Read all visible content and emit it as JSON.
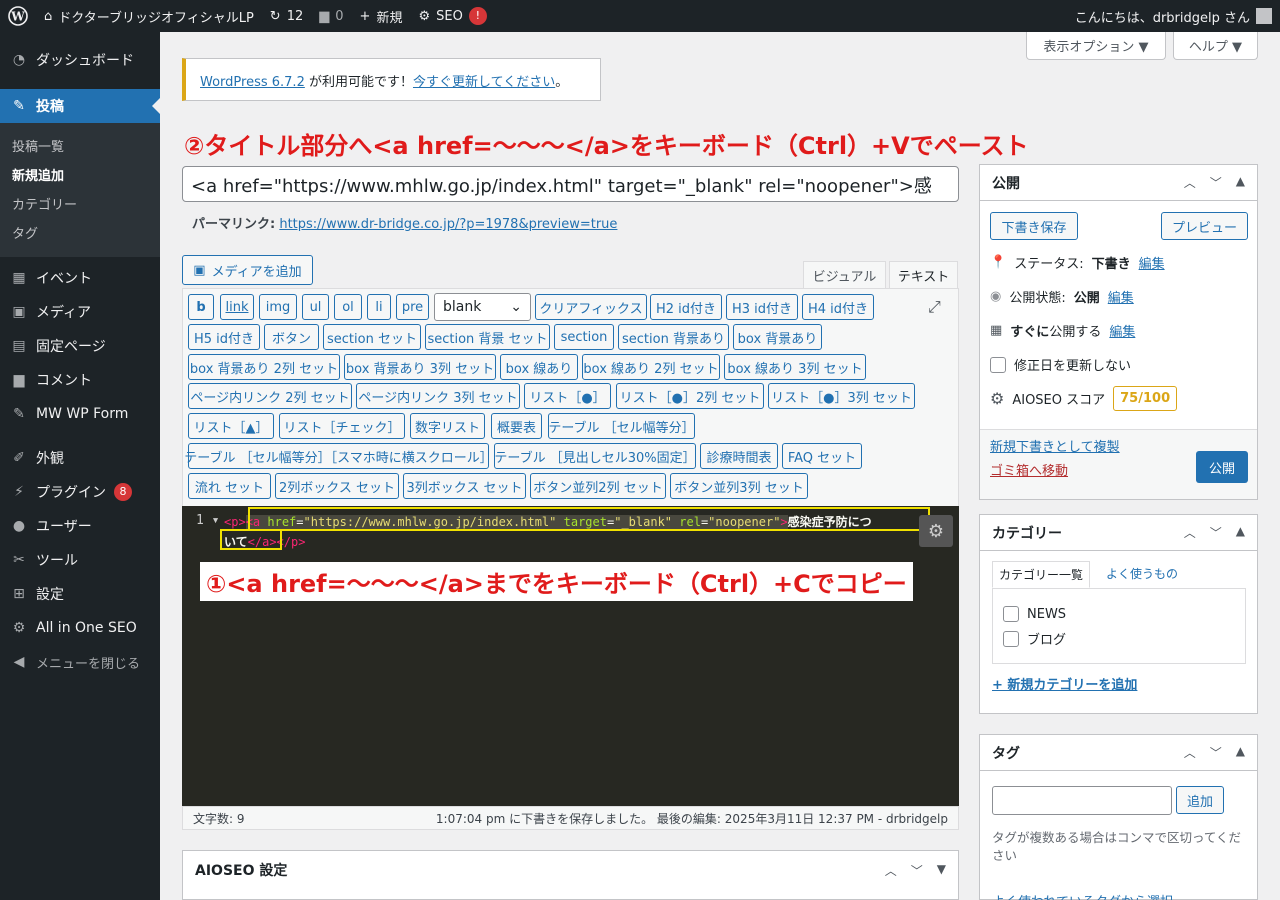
{
  "adminbar": {
    "site": "ドクターブリッジオフィシャルLP",
    "updates": "12",
    "comments": "0",
    "new": "新規",
    "seo": "SEO",
    "seo_badge": "!",
    "greeting": "こんにちは、drbridgelp さん"
  },
  "sidebar": {
    "items": [
      {
        "label": "ダッシュボード",
        "icon": "dashboard-icon"
      },
      {
        "label": "投稿",
        "icon": "pin-icon"
      },
      {
        "label": "イベント",
        "icon": "calendar-icon"
      },
      {
        "label": "メディア",
        "icon": "media-icon"
      },
      {
        "label": "固定ページ",
        "icon": "page-icon"
      },
      {
        "label": "コメント",
        "icon": "comment-icon"
      },
      {
        "label": "MW WP Form",
        "icon": "pin-icon"
      },
      {
        "label": "外観",
        "icon": "brush-icon"
      },
      {
        "label": "プラグイン",
        "icon": "plugin-icon",
        "badge": "8"
      },
      {
        "label": "ユーザー",
        "icon": "user-icon"
      },
      {
        "label": "ツール",
        "icon": "wrench-icon"
      },
      {
        "label": "設定",
        "icon": "settings-icon"
      },
      {
        "label": "All in One SEO",
        "icon": "gear-icon"
      },
      {
        "label": "メニューを閉じる",
        "icon": "collapse-icon"
      }
    ],
    "sub": [
      "投稿一覧",
      "新規追加",
      "カテゴリー",
      "タグ"
    ]
  },
  "screen": {
    "options": "表示オプション ▼",
    "help": "ヘルプ ▼"
  },
  "notice": {
    "link": "WordPress 6.7.2",
    "text": " が利用可能です！",
    "link2": "今すぐ更新してください",
    "end": "。"
  },
  "annotation2": "②タイトル部分へ<a href=～～～</a>をキーボード（Ctrl）+Vでペースト",
  "annotation1": "①<a href=～～～</a>までをキーボード（Ctrl）+Cでコピー",
  "title_value": "<a href=\"https://www.mhlw.go.jp/index.html\" target=\"_blank\" rel=\"noopener\">感",
  "permalink": {
    "label": "パーマリンク:",
    "url": "https://www.dr-bridge.co.jp/?p=1978&preview=true"
  },
  "media_button": "メディアを追加",
  "tabs": {
    "visual": "ビジュアル",
    "text": "テキスト"
  },
  "quicktags": [
    "b",
    "link",
    "img",
    "ul",
    "ol",
    "li",
    "pre",
    "クリアフィックス",
    "H2 id付き",
    "H3 id付き",
    "H4 id付き",
    "H5 id付き",
    "ボタン",
    "section セット",
    "section 背景 セット",
    "section",
    "section 背景あり",
    "box 背景あり",
    "box 背景あり 2列 セット",
    "box 背景あり 3列 セット",
    "box 線あり",
    "box 線あり 2列 セット",
    "box 線あり 3列 セット",
    "ページ内リンク 2列 セット",
    "ページ内リンク 3列 セット",
    "リスト［●］",
    "リスト［●］2列 セット",
    "リスト［●］3列 セット",
    "リスト［▲］",
    "リスト［チェック］",
    "数字リスト",
    "概要表",
    "テーブル ［セル幅等分］",
    "テーブル ［セル幅等分］［スマホ時に横スクロール］",
    "テーブル ［見出しセル30%固定］",
    "診療時間表",
    "FAQ セット",
    "流れ セット",
    "2列ボックス セット",
    "3列ボックス セット",
    "ボタン並列2列 セット",
    "ボタン並列3列 セット"
  ],
  "select_value": "blank",
  "code": {
    "line_no": "1",
    "p_open": "<p>",
    "a_open": "<a",
    "href_attr": "href",
    "href_val": "\"https://www.mhlw.go.jp/index.html\"",
    "target_attr": "target",
    "target_val": "\"_blank\"",
    "rel_attr": "rel",
    "rel_val": "\"noopener\"",
    "gt": ">",
    "text1": "感染症予防につ",
    "text2": "いて",
    "a_close": "</a>",
    "p_close": "</p>"
  },
  "status": {
    "count": "文字数: 9",
    "saved": "1:07:04 pm に下書きを保存しました。 最後の編集: 2025年3月11日 12:37 PM - drbridgelp"
  },
  "aioseo": "AIOSEO 設定",
  "publish": {
    "title": "公開",
    "save": "下書き保存",
    "preview": "プレビュー",
    "status_label": "ステータス:",
    "status_val": "下書き",
    "edit": "編集",
    "vis_label": "公開状態:",
    "vis_val": "公開",
    "when_b": "すぐに",
    "when": "公開する",
    "update_date": "修正日を更新しない",
    "aioseo_label": "AIOSEO スコア",
    "score": "75/100",
    "dup": "新規下書きとして複製",
    "trash": "ゴミ箱へ移動",
    "publish_btn": "公開"
  },
  "category": {
    "title": "カテゴリー",
    "tab1": "カテゴリー一覧",
    "tab2": "よく使うもの",
    "items": [
      "NEWS",
      "ブログ"
    ],
    "add": "+ 新規カテゴリーを追加"
  },
  "tag": {
    "title": "タグ",
    "add": "追加",
    "hint": "タグが複数ある場合はコンマで区切ってください",
    "popular": "よく使われているタグから選択"
  }
}
